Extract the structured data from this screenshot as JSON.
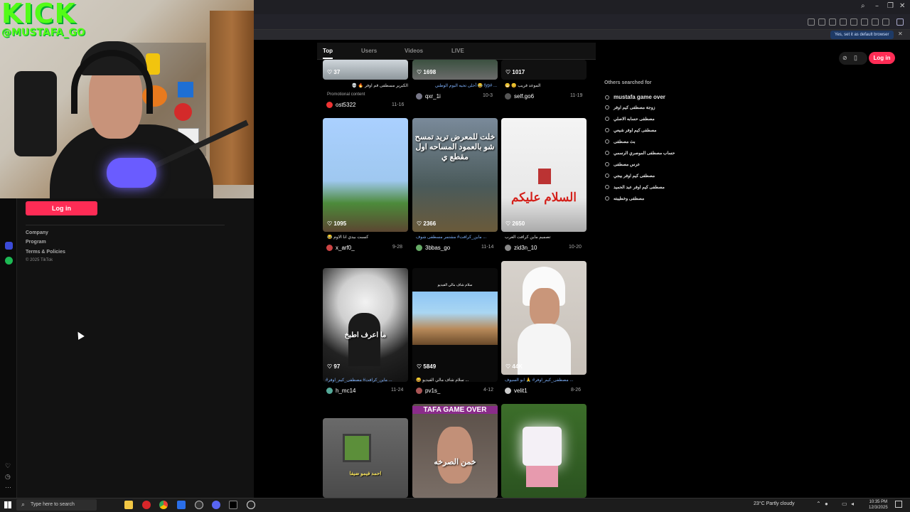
{
  "stream_overlay": {
    "brand": "KICK",
    "handle": "@MUSTAFA_GO"
  },
  "left_panel": {
    "login_label": "Log in",
    "footer_links": [
      "Company",
      "Program",
      "Terms & Policies"
    ],
    "copyright": "© 2025 TikTok"
  },
  "tabs": [
    {
      "label": "Top",
      "active": true
    },
    {
      "label": "Users",
      "active": false
    },
    {
      "label": "Videos",
      "active": false
    },
    {
      "label": "LIVE",
      "active": false
    }
  ],
  "browser": {
    "notification": "Yes, set it as default browser"
  },
  "videos_row0": [
    {
      "likes": "37",
      "caption": "الكبرير مسطفى قم اوفر 🔥 💀",
      "promo": "Promotional content",
      "author": "ost5322",
      "date": "11-16"
    },
    {
      "likes": "1698",
      "caption": "... #fyp 😂 أحلى تحيه اليوم الوطني",
      "author": "qxr_1i",
      "date": "10-3"
    },
    {
      "likes": "1017",
      "caption": "الموعد قريب 😊 😁",
      "author": "self.go6",
      "date": "11-19"
    }
  ],
  "videos_row1": [
    {
      "likes": "1095",
      "caption": "كسبت بيدي انا الاوم 😂",
      "overlay": "",
      "author": "x_arf0_",
      "date": "9-28"
    },
    {
      "likes": "2366",
      "caption": "... ماين_كرافت# مشتمر مسطفى شوف",
      "overlay": "خلت للمعرض تريد تمسح شو بالعمود المساحه اول مقطع ي",
      "author": "3bbas_go",
      "date": "11-14"
    },
    {
      "likes": "2650",
      "caption": "تصميم ماين كرافت العرب",
      "overlay": "السلام عليكم",
      "author": "zid3n_10",
      "date": "10-20"
    }
  ],
  "videos_row2": [
    {
      "likes": "97",
      "caption": "... ماين_كرافت# مصطفى_كيم_اوفر#",
      "overlay": "ما اعرف اطبخ",
      "author": "h_mc14",
      "date": "11-24"
    },
    {
      "likes": "5849",
      "caption": "... سلام شاف مالي الفيديو 😄",
      "overlay": "سلام شاف مالي الفيديو",
      "author": "pv1s_",
      "date": "4-12"
    },
    {
      "likes": "44K",
      "caption": "... مصطفى_كيم_اوفر# 🙏 ابو السيوف",
      "overlay": "",
      "author": "velit1",
      "date": "8-26"
    }
  ],
  "videos_row3": [
    {
      "overlay": "احمد فيمو ضيفا"
    },
    {
      "overlay": "خمن الصرخه",
      "top_text": "TAFA GAME OVER"
    },
    {
      "overlay": ""
    }
  ],
  "others_searched": {
    "title": "Others searched for",
    "items": [
      "mustafa game over",
      "زوجة مصطفى كيم اوفر",
      "مصطفى حسابه الاصلي",
      "مصطفى كيم اوفر شيعي",
      "بث مصطفى",
      "حساب مصطفى الموصري الرسمي",
      "عرس مصطفى",
      "مصطفى كيم اوفر بيجي",
      "مصطفى كيم اوفر عبد الحميد",
      "مصطفى وخطيبته"
    ]
  },
  "header_right": {
    "login_label": "Log in"
  },
  "taskbar": {
    "search_placeholder": "Type here to search",
    "weather": "23°C  Partly cloudy",
    "time": "10:35 PM",
    "date": "12/3/2025"
  },
  "colors": {
    "accent": "#fe2c55",
    "kick_green": "#53fc18"
  }
}
